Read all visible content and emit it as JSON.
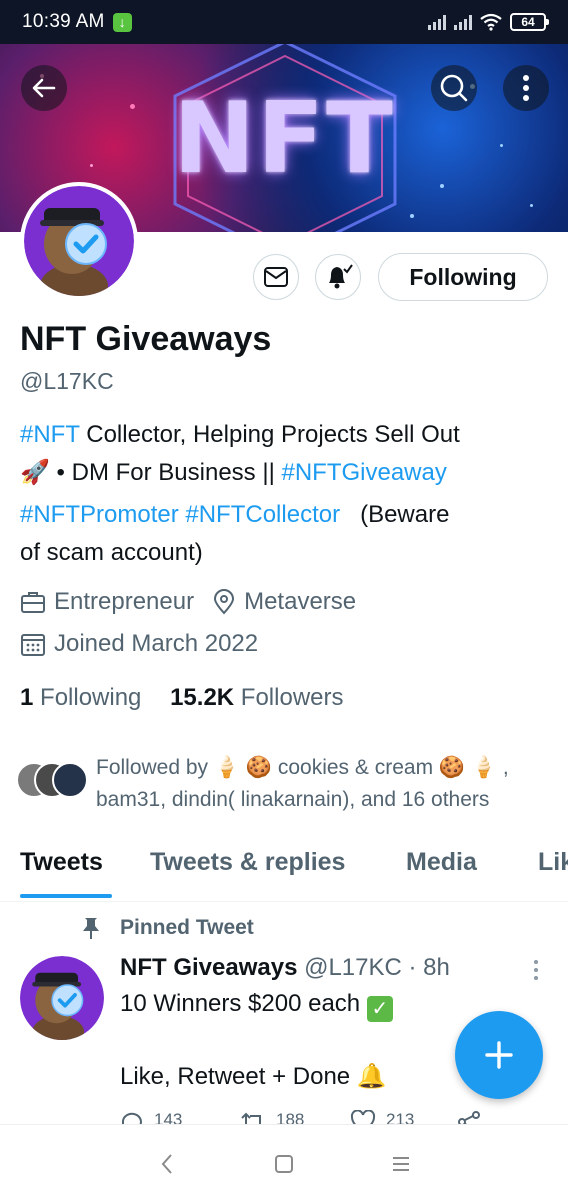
{
  "status_bar": {
    "time": "10:39 AM",
    "download_icon": "download-arrow-icon",
    "battery": "64"
  },
  "banner": {
    "text": "NFT",
    "colors": {
      "left": "#c2185b",
      "right": "#1b63d8",
      "dark": "#131437"
    }
  },
  "profile": {
    "name": "NFT Giveaways",
    "handle": "@L17KC",
    "follow_state": "Following",
    "bio": {
      "line1_tag": "#NFT",
      "line1_text": " Collector, Helping Projects Sell Out",
      "line2_emoji": "🚀",
      "line2_text": " • DM For Business || ",
      "line2_tag": "#NFTGiveaway",
      "line3_tag1": "#NFTPromoter",
      "line3_tag2": "#NFTCollector",
      "line3_text": "   (Beware",
      "line4_text": "of scam account)"
    },
    "profession": "Entrepreneur",
    "location": "Metaverse",
    "joined": "Joined March 2022",
    "following_count": "1",
    "following_label": " Following",
    "followers_count": "15.2K",
    "followers_label": " Followers",
    "followed_by_line1": "Followed by 🍦 🍪 cookies & cream 🍪 🍦 ,",
    "followed_by_line2": "bam31, dindin( linakarnain), and 16 others"
  },
  "tabs": [
    "Tweets",
    "Tweets & replies",
    "Media",
    "Likes"
  ],
  "pinned_tweet": {
    "label": "Pinned Tweet",
    "author_name": "NFT Giveaways",
    "author_handle": "@L17KC",
    "time": " · 8h",
    "line1": "10 Winners $200 each",
    "line2": "Like, Retweet + Done 🔔",
    "replies": "143",
    "retweets": "188",
    "likes": "213"
  },
  "accent_color": "#1d9bf0",
  "avatar_color": "#7b2fd1"
}
